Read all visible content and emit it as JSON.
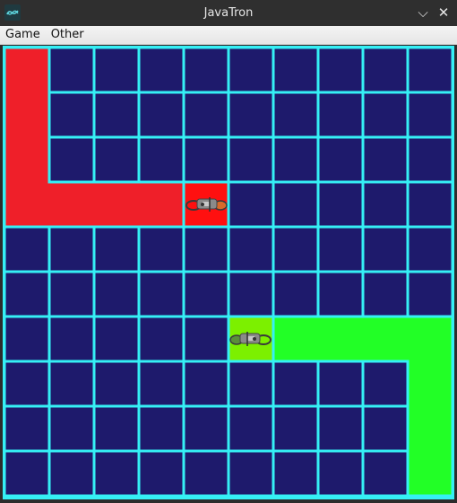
{
  "window": {
    "title": "JavaTron",
    "app_icon": "tron-app-icon",
    "minimize_glyph": "⌵",
    "close_glyph": "✕"
  },
  "menu": {
    "items": [
      {
        "label": "Game"
      },
      {
        "label": "Other"
      }
    ]
  },
  "game": {
    "grid_cols": 10,
    "grid_rows": 10,
    "colors": {
      "empty": "#1e1a6c",
      "grid_line": "#35f0f5",
      "red_trail": "#ef1f29",
      "red_head": "#ff1010",
      "green_trail": "#22ff26",
      "green_head": "#7cf000",
      "background": "#e9e9e9"
    },
    "red_player": {
      "trail": [
        [
          0,
          0
        ],
        [
          0,
          1
        ],
        [
          0,
          2
        ],
        [
          0,
          3
        ],
        [
          1,
          3
        ],
        [
          2,
          3
        ],
        [
          3,
          3
        ]
      ],
      "head": [
        4,
        3
      ],
      "facing": "right"
    },
    "green_player": {
      "trail": [
        [
          9,
          9
        ],
        [
          9,
          8
        ],
        [
          9,
          7
        ],
        [
          9,
          6
        ],
        [
          8,
          6
        ],
        [
          7,
          6
        ],
        [
          6,
          6
        ]
      ],
      "head": [
        5,
        6
      ],
      "facing": "left"
    }
  }
}
